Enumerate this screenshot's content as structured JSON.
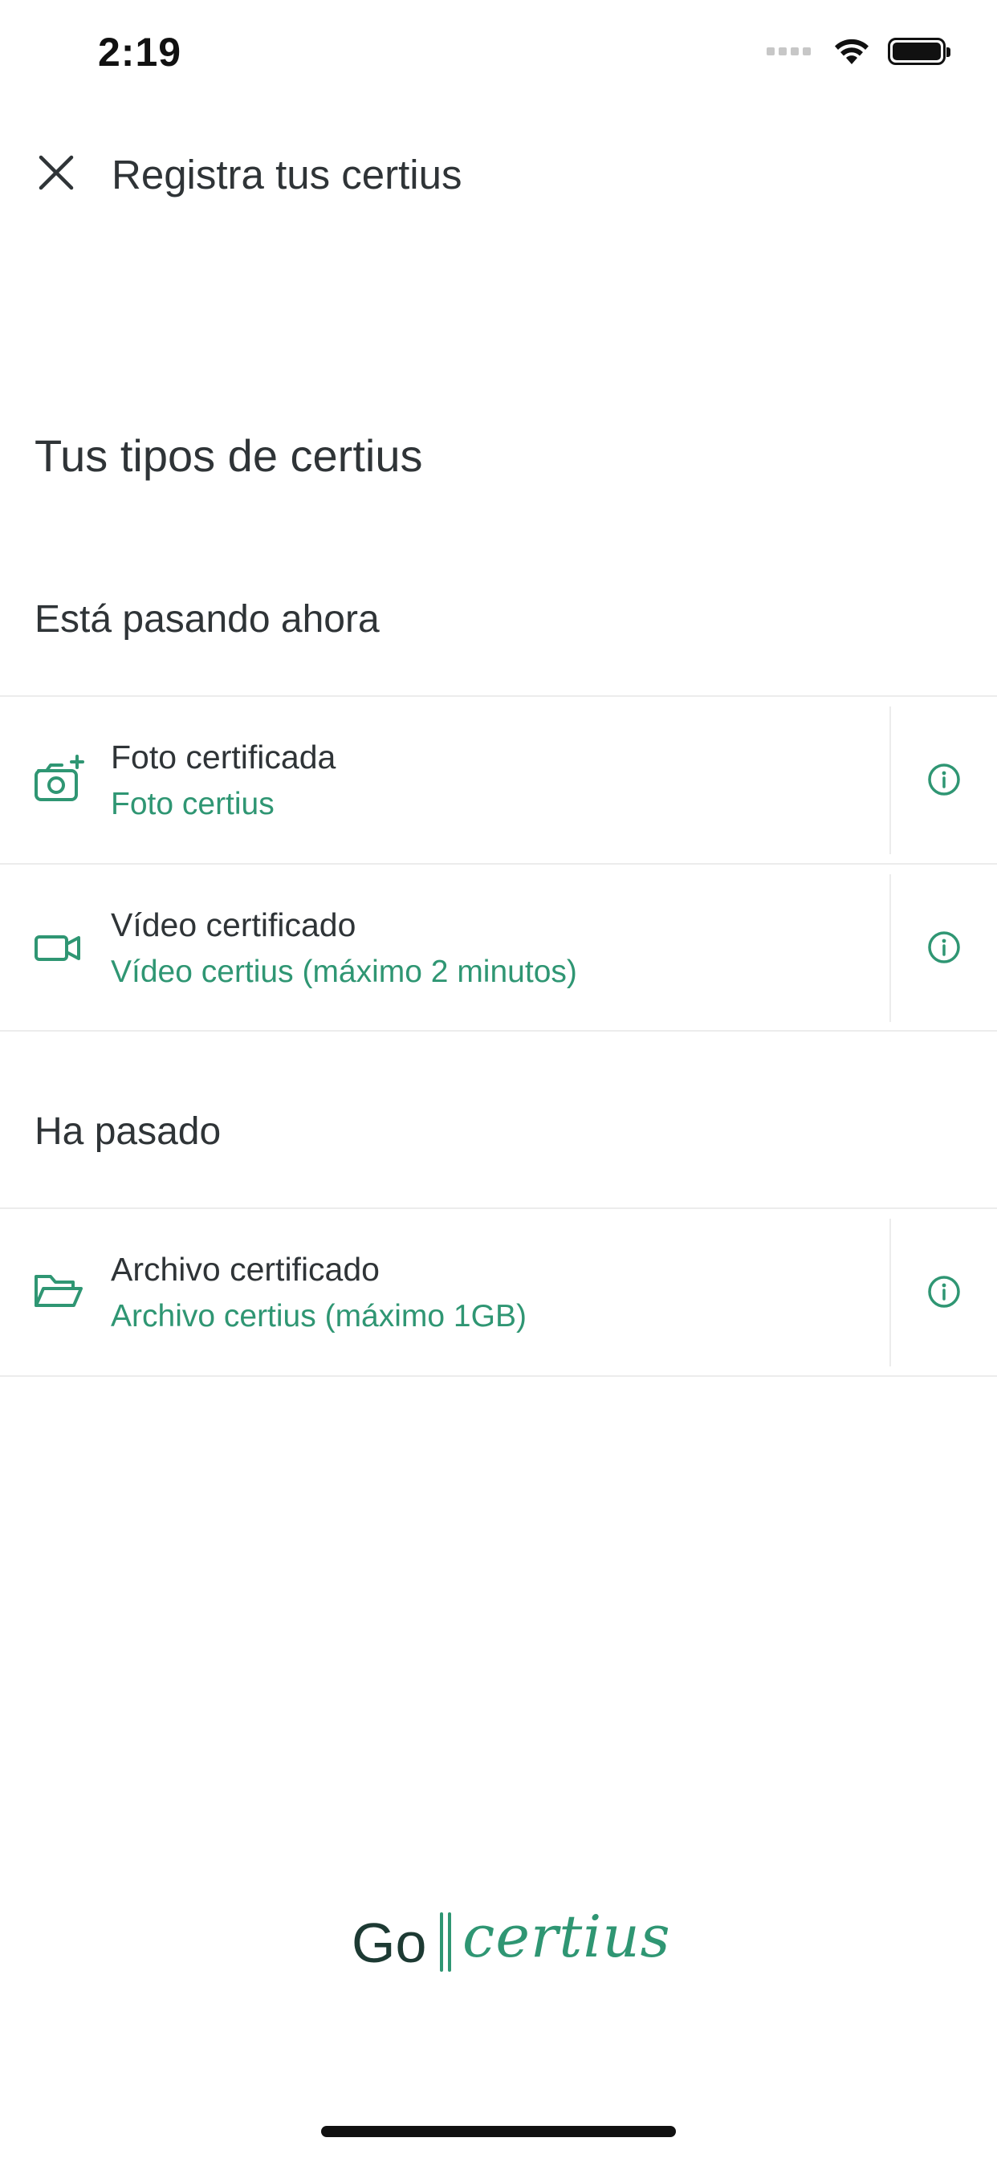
{
  "status_bar": {
    "time": "2:19",
    "icons": [
      "signal-icon",
      "wifi-icon",
      "battery-icon"
    ]
  },
  "header": {
    "title": "Registra tus certius",
    "close_icon": "close-icon"
  },
  "main": {
    "section_title": "Tus tipos de certius",
    "groups": [
      {
        "label": "Está pasando ahora",
        "items": [
          {
            "icon": "camera-add-icon",
            "title": "Foto certificada",
            "subtitle": "Foto certius",
            "info_icon": "info-icon"
          },
          {
            "icon": "video-camera-icon",
            "title": "Vídeo certificado",
            "subtitle": "Vídeo certius (máximo 2 minutos)",
            "info_icon": "info-icon"
          }
        ]
      },
      {
        "label": "Ha pasado",
        "items": [
          {
            "icon": "folder-open-icon",
            "title": "Archivo certificado",
            "subtitle": "Archivo certius (máximo 1GB)",
            "info_icon": "info-icon"
          }
        ]
      }
    ]
  },
  "footer": {
    "logo_text_go": "Go",
    "logo_text_certius": "certius"
  },
  "colors": {
    "accent": "#2f9673",
    "text": "#2f3437",
    "divider": "#ececec",
    "logo_dark": "#1d3a33"
  }
}
